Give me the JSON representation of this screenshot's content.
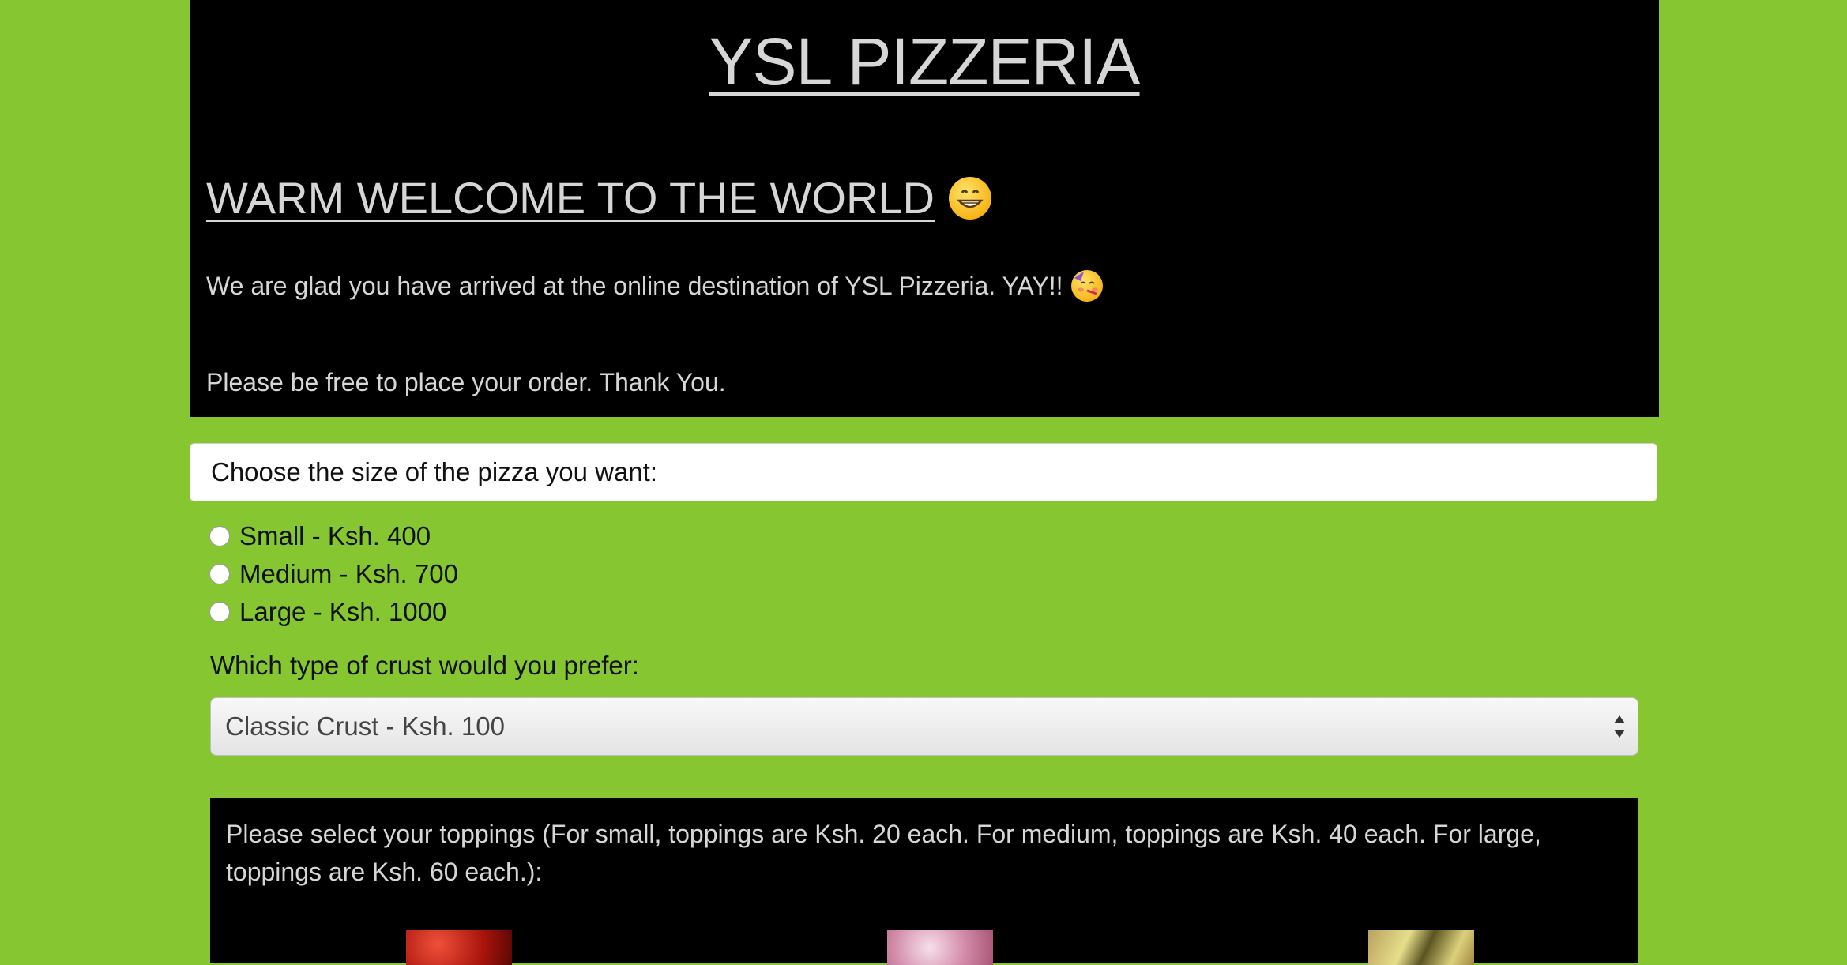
{
  "header": {
    "site_title": "YSL PIZZERIA",
    "welcome": "WARM WELCOME TO THE WORLD",
    "intro": "We are glad you have arrived at the online destination of YSL Pizzeria. YAY!!",
    "thanks": "Please be free to place your order. Thank You."
  },
  "order": {
    "size_prompt": "Choose the size of the pizza you want:",
    "sizes": [
      {
        "label": "Small - Ksh. 400",
        "checked": false
      },
      {
        "label": "Medium - Ksh. 700",
        "checked": false
      },
      {
        "label": "Large - Ksh. 1000",
        "checked": false
      }
    ],
    "crust_prompt": "Which type of crust would you prefer:",
    "crust_selected": "Classic Crust - Ksh. 100",
    "toppings_prompt": "Please select your toppings (For small, toppings are Ksh. 20 each. For medium, toppings are Ksh. 40 each. For large, toppings are Ksh. 60 each.):"
  },
  "colors": {
    "page_background": "#86c631",
    "panel_background": "#000000",
    "panel_text": "#d6d6d6"
  },
  "icons": [
    "grinning-face-icon",
    "partying-face-icon",
    "select-arrows-icon"
  ]
}
